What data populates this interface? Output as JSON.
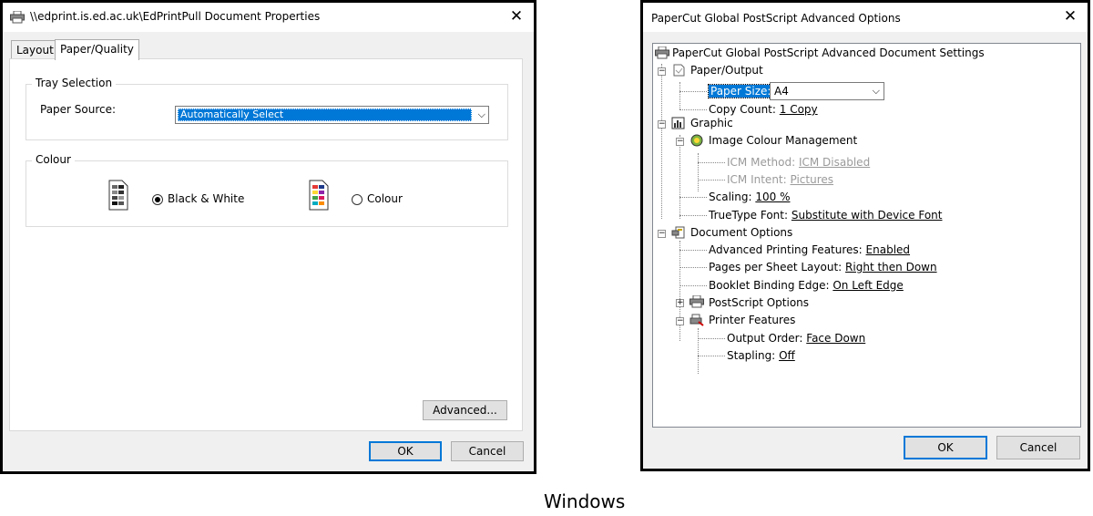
{
  "props_dialog": {
    "title": "\\\\edprint.is.ed.ac.uk\\EdPrintPull Document Properties",
    "tabs": [
      "Layout",
      "Paper/Quality"
    ],
    "tray_group": "Tray Selection",
    "paper_source_label": "Paper Source:",
    "paper_source_value": "Automatically Select",
    "colour_group": "Colour",
    "bw_label": "Black & White",
    "colour_label": "Colour",
    "bw_selected": true,
    "advanced_button": "Advanced...",
    "ok_button": "OK",
    "cancel_button": "Cancel"
  },
  "adv_dialog": {
    "title": "PaperCut Global PostScript Advanced Options",
    "root": "PaperCut Global PostScript Advanced Document Settings",
    "paper_output": "Paper/Output",
    "paper_size_label": "Paper Size:",
    "paper_size_value": "A4",
    "copy_count_label": "Copy Count:",
    "copy_count_value": "1 Copy",
    "graphic": "Graphic",
    "icm": "Image Colour Management",
    "icm_method_label": "ICM Method:",
    "icm_method_value": "ICM Disabled",
    "icm_intent_label": "ICM Intent:",
    "icm_intent_value": "Pictures",
    "scaling_label": "Scaling:",
    "scaling_value": "100 %",
    "truetype_label": "TrueType Font:",
    "truetype_value": "Substitute with Device Font",
    "doc_options": "Document Options",
    "adv_print_label": "Advanced Printing Features:",
    "adv_print_value": "Enabled",
    "pages_layout_label": "Pages per Sheet Layout:",
    "pages_layout_value": "Right then Down",
    "booklet_label": "Booklet Binding Edge:",
    "booklet_value": "On Left Edge",
    "postscript_options": "PostScript Options",
    "printer_features": "Printer Features",
    "output_order_label": "Output Order:",
    "output_order_value": "Face Down",
    "stapling_label": "Stapling:",
    "stapling_value": "Off",
    "ok_button": "OK",
    "cancel_button": "Cancel"
  },
  "caption": "Windows",
  "colors": {
    "accent": "#0078d7",
    "panel": "#f0f0f0",
    "border": "#000000"
  },
  "icons": [
    "printer-icon",
    "close-icon",
    "chevron-down-icon",
    "bw-document-icon",
    "colour-document-icon",
    "paper-output-icon",
    "graphic-icon",
    "colour-management-icon",
    "document-options-icon",
    "postscript-icon",
    "printer-features-icon"
  ]
}
